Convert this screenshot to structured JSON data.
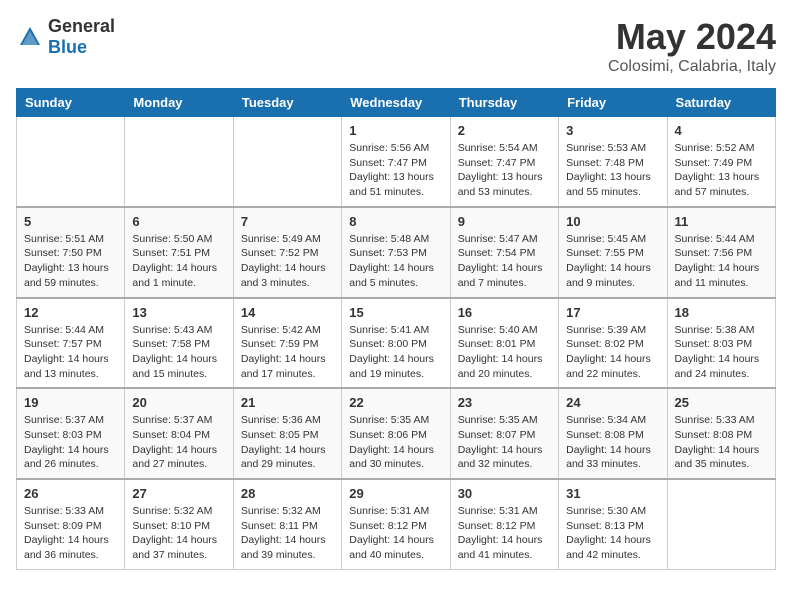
{
  "header": {
    "logo_general": "General",
    "logo_blue": "Blue",
    "title": "May 2024",
    "subtitle": "Colosimi, Calabria, Italy"
  },
  "days_of_week": [
    "Sunday",
    "Monday",
    "Tuesday",
    "Wednesday",
    "Thursday",
    "Friday",
    "Saturday"
  ],
  "weeks": [
    {
      "days": [
        {
          "num": "",
          "info": ""
        },
        {
          "num": "",
          "info": ""
        },
        {
          "num": "",
          "info": ""
        },
        {
          "num": "1",
          "info": "Sunrise: 5:56 AM\nSunset: 7:47 PM\nDaylight: 13 hours\nand 51 minutes."
        },
        {
          "num": "2",
          "info": "Sunrise: 5:54 AM\nSunset: 7:47 PM\nDaylight: 13 hours\nand 53 minutes."
        },
        {
          "num": "3",
          "info": "Sunrise: 5:53 AM\nSunset: 7:48 PM\nDaylight: 13 hours\nand 55 minutes."
        },
        {
          "num": "4",
          "info": "Sunrise: 5:52 AM\nSunset: 7:49 PM\nDaylight: 13 hours\nand 57 minutes."
        }
      ]
    },
    {
      "days": [
        {
          "num": "5",
          "info": "Sunrise: 5:51 AM\nSunset: 7:50 PM\nDaylight: 13 hours\nand 59 minutes."
        },
        {
          "num": "6",
          "info": "Sunrise: 5:50 AM\nSunset: 7:51 PM\nDaylight: 14 hours\nand 1 minute."
        },
        {
          "num": "7",
          "info": "Sunrise: 5:49 AM\nSunset: 7:52 PM\nDaylight: 14 hours\nand 3 minutes."
        },
        {
          "num": "8",
          "info": "Sunrise: 5:48 AM\nSunset: 7:53 PM\nDaylight: 14 hours\nand 5 minutes."
        },
        {
          "num": "9",
          "info": "Sunrise: 5:47 AM\nSunset: 7:54 PM\nDaylight: 14 hours\nand 7 minutes."
        },
        {
          "num": "10",
          "info": "Sunrise: 5:45 AM\nSunset: 7:55 PM\nDaylight: 14 hours\nand 9 minutes."
        },
        {
          "num": "11",
          "info": "Sunrise: 5:44 AM\nSunset: 7:56 PM\nDaylight: 14 hours\nand 11 minutes."
        }
      ]
    },
    {
      "days": [
        {
          "num": "12",
          "info": "Sunrise: 5:44 AM\nSunset: 7:57 PM\nDaylight: 14 hours\nand 13 minutes."
        },
        {
          "num": "13",
          "info": "Sunrise: 5:43 AM\nSunset: 7:58 PM\nDaylight: 14 hours\nand 15 minutes."
        },
        {
          "num": "14",
          "info": "Sunrise: 5:42 AM\nSunset: 7:59 PM\nDaylight: 14 hours\nand 17 minutes."
        },
        {
          "num": "15",
          "info": "Sunrise: 5:41 AM\nSunset: 8:00 PM\nDaylight: 14 hours\nand 19 minutes."
        },
        {
          "num": "16",
          "info": "Sunrise: 5:40 AM\nSunset: 8:01 PM\nDaylight: 14 hours\nand 20 minutes."
        },
        {
          "num": "17",
          "info": "Sunrise: 5:39 AM\nSunset: 8:02 PM\nDaylight: 14 hours\nand 22 minutes."
        },
        {
          "num": "18",
          "info": "Sunrise: 5:38 AM\nSunset: 8:03 PM\nDaylight: 14 hours\nand 24 minutes."
        }
      ]
    },
    {
      "days": [
        {
          "num": "19",
          "info": "Sunrise: 5:37 AM\nSunset: 8:03 PM\nDaylight: 14 hours\nand 26 minutes."
        },
        {
          "num": "20",
          "info": "Sunrise: 5:37 AM\nSunset: 8:04 PM\nDaylight: 14 hours\nand 27 minutes."
        },
        {
          "num": "21",
          "info": "Sunrise: 5:36 AM\nSunset: 8:05 PM\nDaylight: 14 hours\nand 29 minutes."
        },
        {
          "num": "22",
          "info": "Sunrise: 5:35 AM\nSunset: 8:06 PM\nDaylight: 14 hours\nand 30 minutes."
        },
        {
          "num": "23",
          "info": "Sunrise: 5:35 AM\nSunset: 8:07 PM\nDaylight: 14 hours\nand 32 minutes."
        },
        {
          "num": "24",
          "info": "Sunrise: 5:34 AM\nSunset: 8:08 PM\nDaylight: 14 hours\nand 33 minutes."
        },
        {
          "num": "25",
          "info": "Sunrise: 5:33 AM\nSunset: 8:08 PM\nDaylight: 14 hours\nand 35 minutes."
        }
      ]
    },
    {
      "days": [
        {
          "num": "26",
          "info": "Sunrise: 5:33 AM\nSunset: 8:09 PM\nDaylight: 14 hours\nand 36 minutes."
        },
        {
          "num": "27",
          "info": "Sunrise: 5:32 AM\nSunset: 8:10 PM\nDaylight: 14 hours\nand 37 minutes."
        },
        {
          "num": "28",
          "info": "Sunrise: 5:32 AM\nSunset: 8:11 PM\nDaylight: 14 hours\nand 39 minutes."
        },
        {
          "num": "29",
          "info": "Sunrise: 5:31 AM\nSunset: 8:12 PM\nDaylight: 14 hours\nand 40 minutes."
        },
        {
          "num": "30",
          "info": "Sunrise: 5:31 AM\nSunset: 8:12 PM\nDaylight: 14 hours\nand 41 minutes."
        },
        {
          "num": "31",
          "info": "Sunrise: 5:30 AM\nSunset: 8:13 PM\nDaylight: 14 hours\nand 42 minutes."
        },
        {
          "num": "",
          "info": ""
        }
      ]
    }
  ]
}
